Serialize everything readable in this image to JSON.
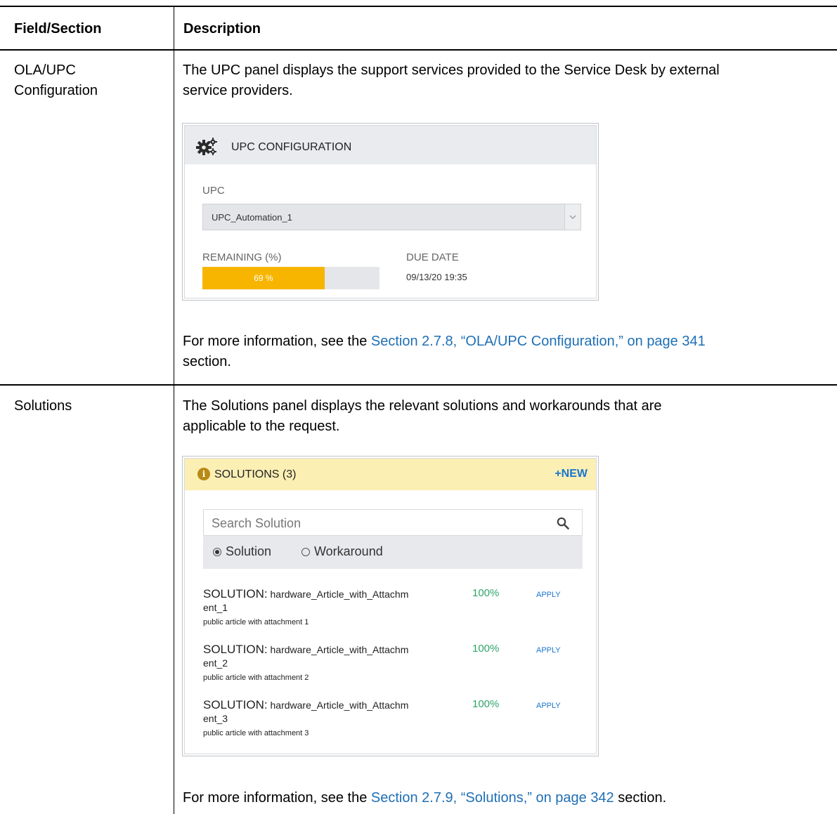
{
  "table": {
    "headers": {
      "field": "Field/Section",
      "description": "Description"
    },
    "rows": [
      {
        "field_line1": "OLA/UPC",
        "field_line2": "Configuration",
        "intro_line1": "The UPC panel displays the support services provided to the Service Desk by external",
        "intro_line2": "service providers.",
        "more_prefix": "For more information, see the ",
        "more_link": "Section 2.7.8, “OLA/UPC Configuration,” on page 341",
        "more_suffix": "section."
      },
      {
        "field_line1": "Solutions",
        "intro_line1": "The Solutions panel displays the relevant solutions and workarounds that are",
        "intro_line2": "applicable to the request.",
        "more_prefix": "For more information, see the ",
        "more_link": "Section 2.7.9, “Solutions,” on page 342",
        "more_suffix": " section."
      }
    ]
  },
  "upc_panel": {
    "title": "UPC CONFIGURATION",
    "icon": "gears-icon",
    "upc_label": "UPC",
    "upc_value": "UPC_Automation_1",
    "remaining_label": "REMAINING (%)",
    "remaining_percent": 69,
    "remaining_text": "69 %",
    "due_label": "DUE DATE",
    "due_value": "09/13/20 19:35",
    "bar_color": "#f7b500"
  },
  "solutions_panel": {
    "title": "SOLUTIONS (3)",
    "icon": "info-icon",
    "new_label": "NEW",
    "search_placeholder": "Search Solution",
    "radio_solution": "Solution",
    "radio_workaround": "Workaround",
    "items": [
      {
        "kw": "SOLUTION:",
        "name_line1": " hardware_Article_with_Attachm",
        "name_line2": "ent_1",
        "desc": "public article with attachment 1",
        "pct": "100%",
        "action": "APPLY"
      },
      {
        "kw": "SOLUTION:",
        "name_line1": " hardware_Article_with_Attachm",
        "name_line2": "ent_2",
        "desc": "public article with attachment 2",
        "pct": "100%",
        "action": "APPLY"
      },
      {
        "kw": "SOLUTION:",
        "name_line1": " hardware_Article_with_Attachm",
        "name_line2": "ent_3",
        "desc": "public article with attachment 3",
        "pct": "100%",
        "action": "APPLY"
      }
    ]
  }
}
